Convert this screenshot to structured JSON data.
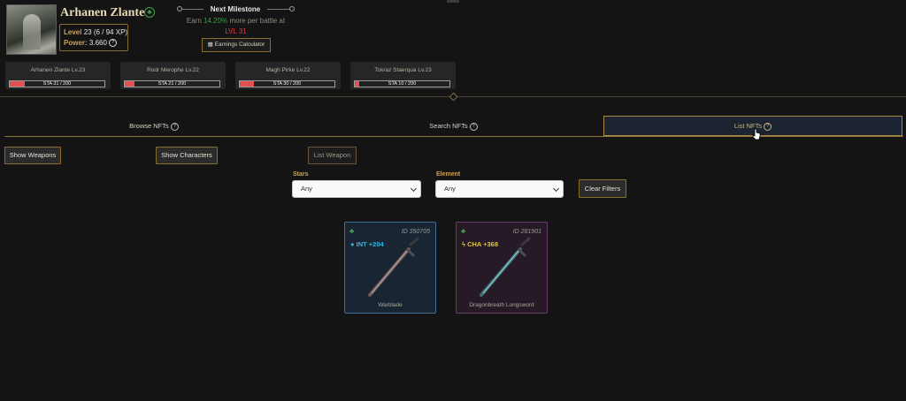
{
  "character": {
    "name": "Arhanen Zlante",
    "level_label": "Level",
    "level_value": "23 (6 / 94 XP)",
    "power_label": "Power:",
    "power_value": "3.660"
  },
  "milestone": {
    "title": "Next Milestone",
    "earn_prefix": "Earn",
    "earn_pct": "14.20%",
    "earn_suffix": "more per battle at",
    "target_level": "LVL 31",
    "calculator_label": "Earnings Calculator"
  },
  "party": [
    {
      "name": "Arhanen Zlante Lv.23",
      "stamina": "STA 31 / 200",
      "stamina_fraction": 0.155
    },
    {
      "name": "Rodr Merophe Lv.22",
      "stamina": "STA 21 / 200",
      "stamina_fraction": 0.105
    },
    {
      "name": "Magh Pirke Lv.22",
      "stamina": "STA 30 / 200",
      "stamina_fraction": 0.15
    },
    {
      "name": "Tokraz Staerqua Lv.23",
      "stamina": "STA 10 / 200",
      "stamina_fraction": 0.05
    }
  ],
  "tabs": {
    "browse": "Browse NFTs",
    "search": "Search NFTs",
    "list": "List NFTs"
  },
  "actions": {
    "show_weapons": "Show Weapons",
    "show_characters": "Show Characters",
    "list_weapon": "List Weapon",
    "clear_filters": "Clear Filters"
  },
  "filters": {
    "stars_label": "Stars",
    "stars_value": "Any",
    "element_label": "Element",
    "element_value": "Any"
  },
  "weapons": [
    {
      "id": "ID 350705",
      "stat": "INT +204",
      "name": "Warblade",
      "stat_color": "#33b6e0",
      "border_color": "#3a6f97",
      "bg": "#1a2533",
      "element_icon": "water-drop-icon"
    },
    {
      "id": "ID 281901",
      "stat": "CHA +368",
      "name": "Dragonbreath Longsword",
      "stat_color": "#e0c43a",
      "border_color": "#6a3a6a",
      "bg": "#251a25",
      "element_icon": "lightning-icon"
    }
  ],
  "colors": {
    "accent_gold": "#a88a45",
    "stamina_red": "#e05252",
    "earth_green": "#3fa34d",
    "level_red": "#e23b3b"
  }
}
